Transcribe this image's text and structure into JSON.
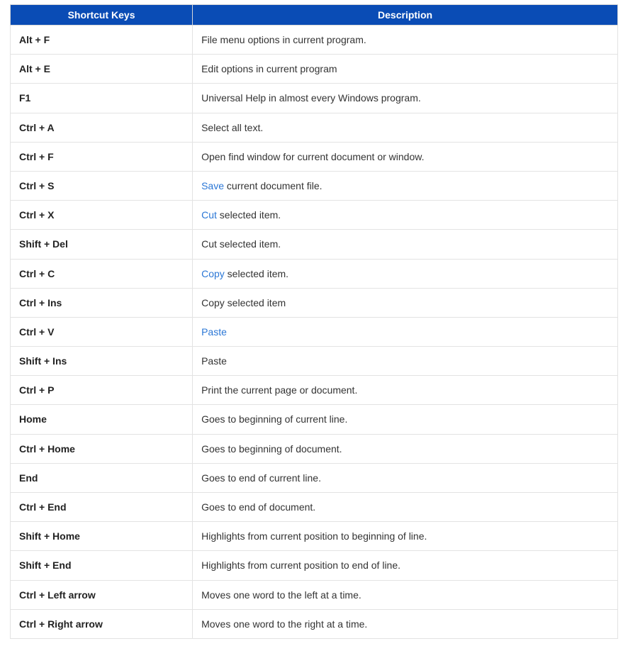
{
  "table": {
    "headers": {
      "key": "Shortcut Keys",
      "desc": "Description"
    },
    "rows": [
      {
        "key": "Alt + F",
        "desc": [
          {
            "t": "text",
            "v": "File menu options in current program."
          }
        ]
      },
      {
        "key": "Alt + E",
        "desc": [
          {
            "t": "text",
            "v": "Edit options in current program"
          }
        ]
      },
      {
        "key": "F1",
        "desc": [
          {
            "t": "text",
            "v": "Universal Help in almost every Windows program."
          }
        ]
      },
      {
        "key": "Ctrl + A",
        "desc": [
          {
            "t": "text",
            "v": "Select all text."
          }
        ]
      },
      {
        "key": "Ctrl + F",
        "desc": [
          {
            "t": "text",
            "v": "Open find window for current document or window."
          }
        ]
      },
      {
        "key": "Ctrl + S",
        "desc": [
          {
            "t": "link",
            "v": "Save"
          },
          {
            "t": "text",
            "v": " current document file."
          }
        ]
      },
      {
        "key": "Ctrl + X",
        "desc": [
          {
            "t": "link",
            "v": "Cut"
          },
          {
            "t": "text",
            "v": " selected item."
          }
        ]
      },
      {
        "key": "Shift + Del",
        "desc": [
          {
            "t": "text",
            "v": "Cut selected item."
          }
        ]
      },
      {
        "key": "Ctrl + C",
        "desc": [
          {
            "t": "link",
            "v": "Copy"
          },
          {
            "t": "text",
            "v": " selected item."
          }
        ]
      },
      {
        "key": "Ctrl + Ins",
        "desc": [
          {
            "t": "text",
            "v": "Copy selected item"
          }
        ]
      },
      {
        "key": "Ctrl + V",
        "desc": [
          {
            "t": "link",
            "v": "Paste"
          }
        ]
      },
      {
        "key": "Shift + Ins",
        "desc": [
          {
            "t": "text",
            "v": "Paste"
          }
        ]
      },
      {
        "key": "Ctrl + P",
        "desc": [
          {
            "t": "text",
            "v": "Print the current page or document."
          }
        ]
      },
      {
        "key": "Home",
        "desc": [
          {
            "t": "text",
            "v": "Goes to beginning of current line."
          }
        ]
      },
      {
        "key": "Ctrl + Home",
        "desc": [
          {
            "t": "text",
            "v": "Goes to beginning of document."
          }
        ]
      },
      {
        "key": "End",
        "desc": [
          {
            "t": "text",
            "v": "Goes to end of current line."
          }
        ]
      },
      {
        "key": "Ctrl + End",
        "desc": [
          {
            "t": "text",
            "v": "Goes to end of document."
          }
        ]
      },
      {
        "key": "Shift + Home",
        "desc": [
          {
            "t": "text",
            "v": "Highlights from current position to beginning of line."
          }
        ]
      },
      {
        "key": "Shift + End",
        "desc": [
          {
            "t": "text",
            "v": "Highlights from current position to end of line."
          }
        ]
      },
      {
        "key": "Ctrl + Left arrow",
        "desc": [
          {
            "t": "text",
            "v": "Moves one word to the left at a time."
          }
        ]
      },
      {
        "key": "Ctrl + Right arrow",
        "desc": [
          {
            "t": "text",
            "v": "Moves one word to the right at a time."
          }
        ]
      }
    ]
  }
}
